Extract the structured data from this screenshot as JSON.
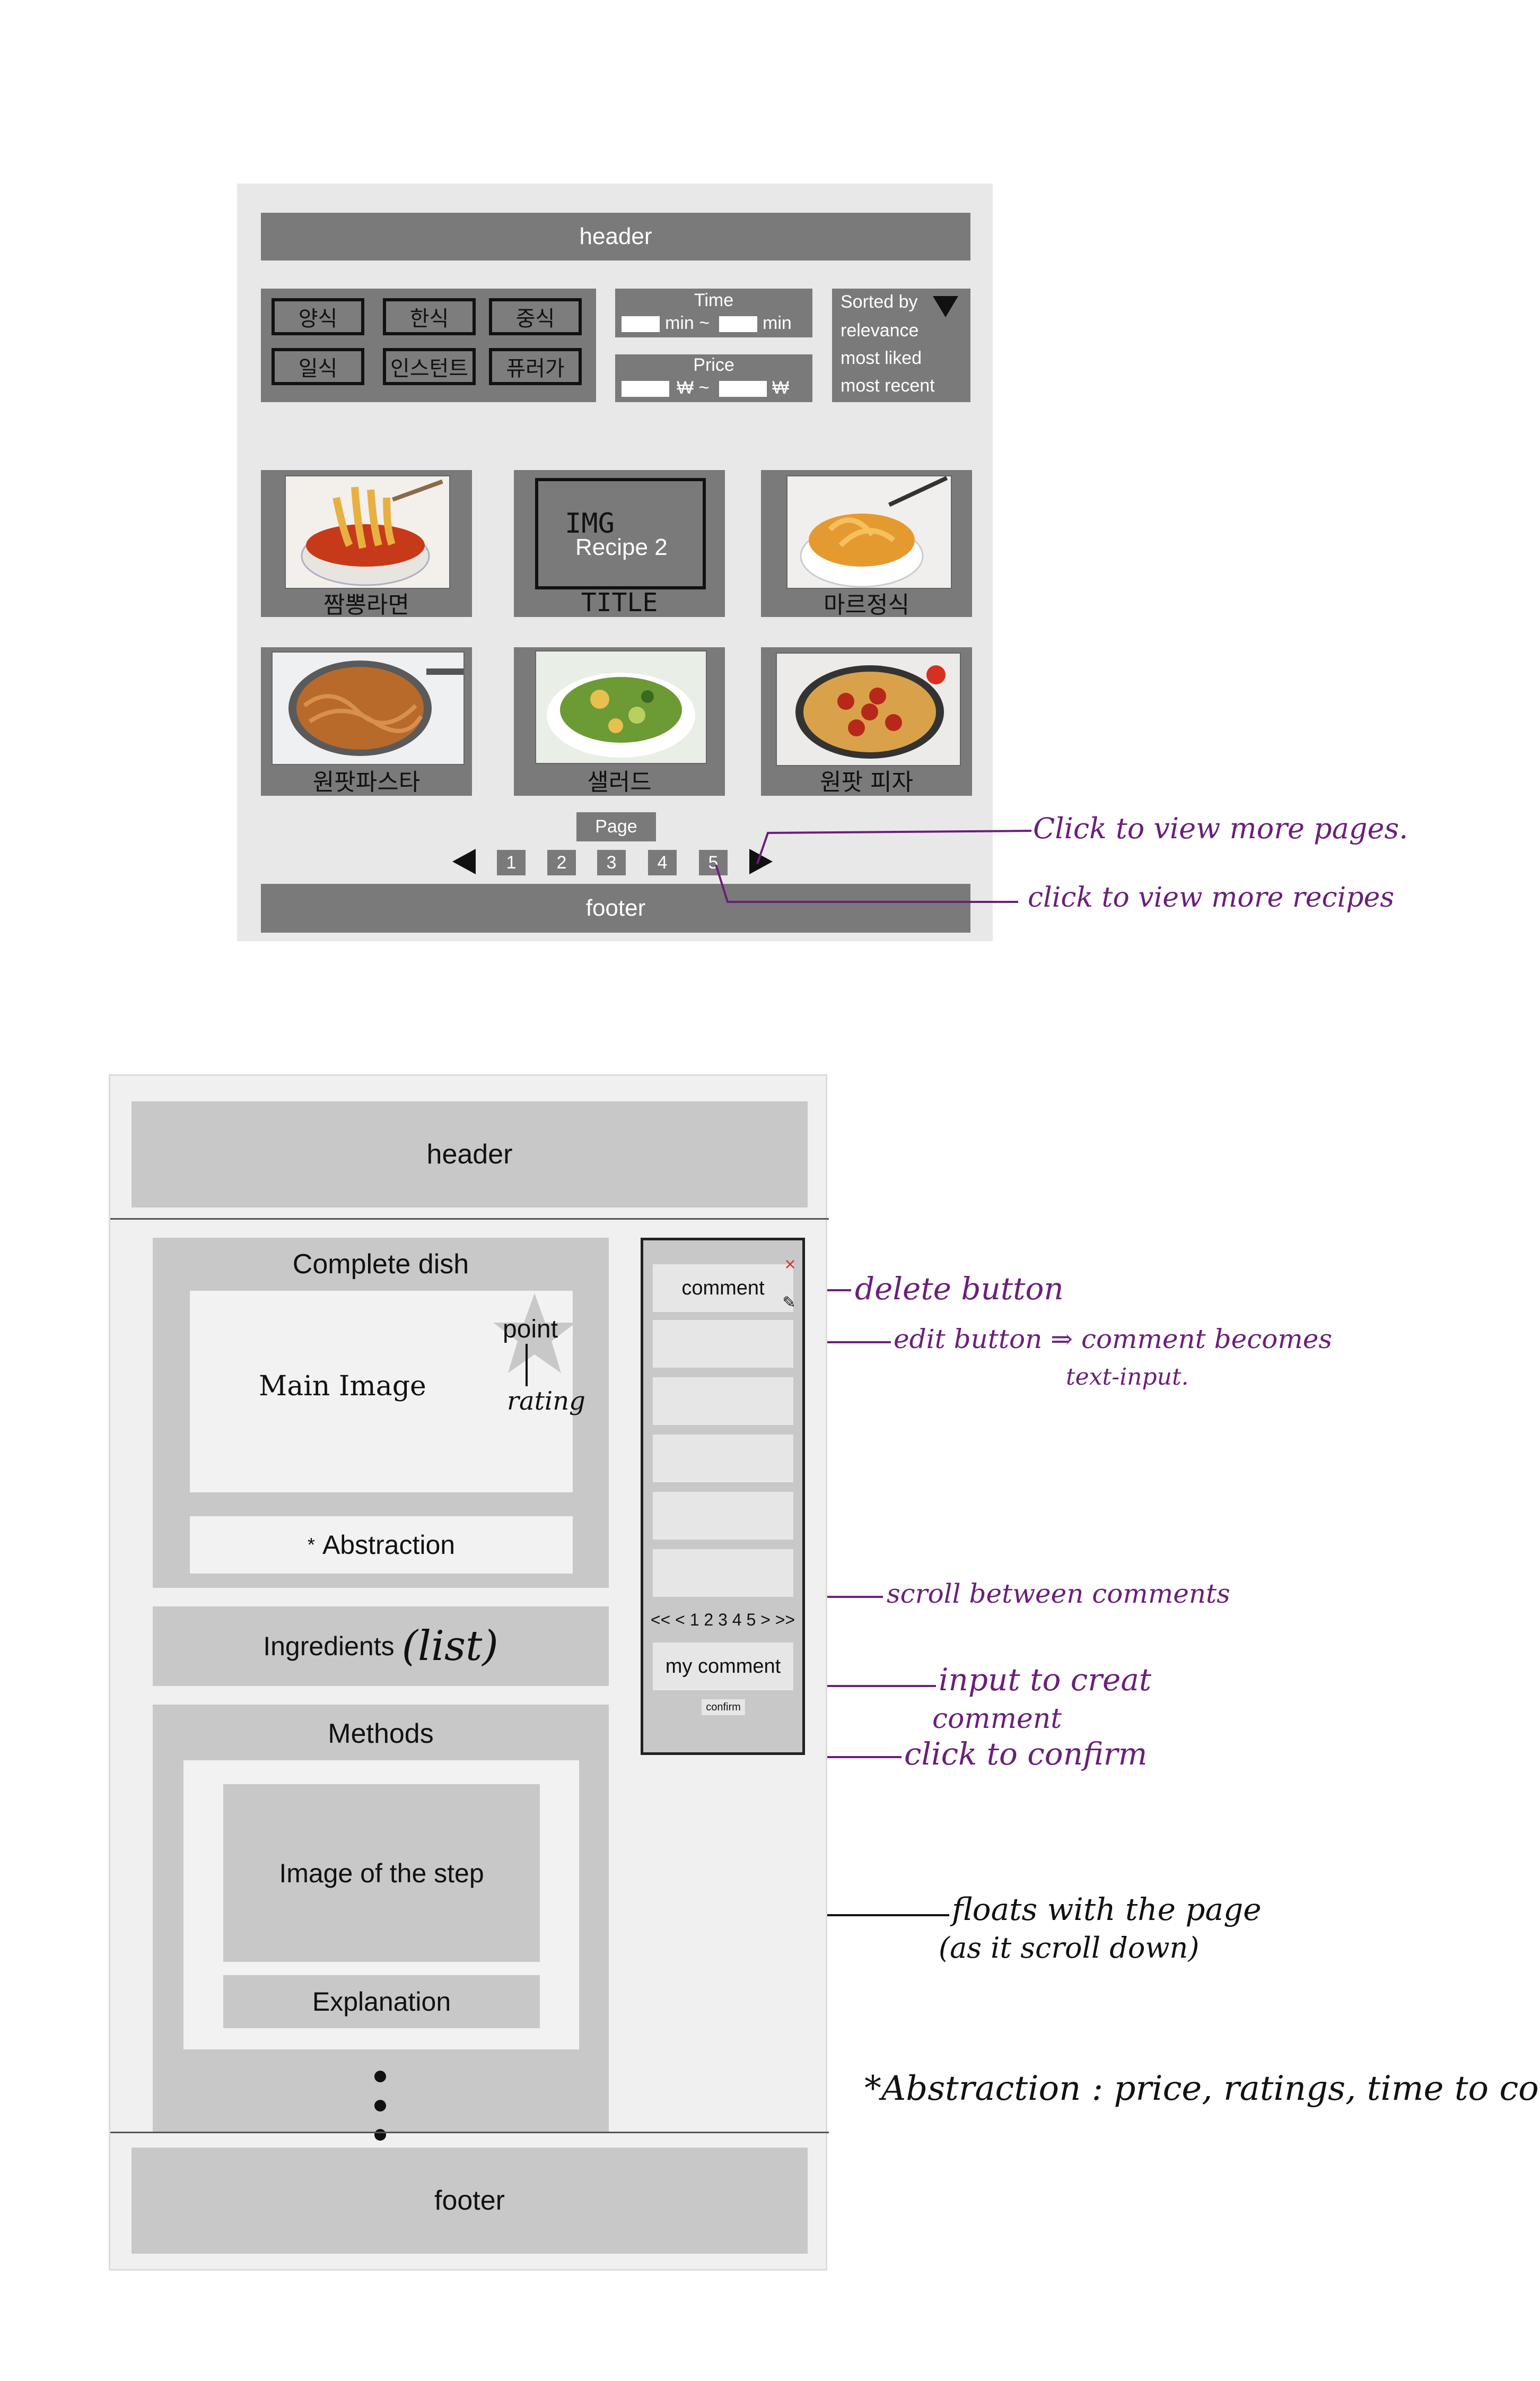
{
  "wireframe1": {
    "header": "header",
    "footer": "footer",
    "categories": [
      "양식",
      "한식",
      "중식",
      "일식",
      "인스턴트",
      "퓨러가"
    ],
    "time_filter": {
      "label": "Time",
      "unit_min": "min ~",
      "unit_max": "min"
    },
    "price_filter": {
      "label": "Price",
      "unit_min": "₩ ~",
      "unit_max": "₩"
    },
    "sort": {
      "label": "Sorted by",
      "options": [
        "relevance",
        "most liked",
        "most recent"
      ]
    },
    "recipes": [
      {
        "title": "짬뽕라면",
        "kind": "photo"
      },
      {
        "title": "TITLE",
        "kind": "placeholder",
        "img_text": "IMG",
        "sub_text": "Recipe 2"
      },
      {
        "title": "마르정식",
        "kind": "photo"
      },
      {
        "title": "원팟파스타",
        "kind": "photo"
      },
      {
        "title": "샐러드",
        "kind": "photo"
      },
      {
        "title": "원팟 피자",
        "kind": "photo"
      }
    ],
    "pagination": {
      "label": "Page",
      "pages": [
        "1",
        "2",
        "3",
        "4",
        "5"
      ]
    }
  },
  "annotations1": {
    "next_pages": "Click to view more pages.",
    "more_recipes": "click to view more recipes"
  },
  "wireframe2": {
    "header": "header",
    "footer": "footer",
    "complete_dish": "Complete dish",
    "main_image": "Main Image",
    "point": "point",
    "rating": "rating",
    "abstraction": "Abstraction",
    "abstraction_star": "*",
    "ingredients": "Ingredients",
    "ingredients_note": "(list)",
    "methods": "Methods",
    "step_image": "Image of the step",
    "explanation": "Explanation",
    "comments": {
      "first": "comment",
      "pager": "<< < 1 2 3 4 5 > >>",
      "my_comment": "my comment",
      "confirm": "confirm"
    }
  },
  "annotations2": {
    "delete": "delete button",
    "edit": "edit button ⇒ comment becomes",
    "edit_cont": "text-input.",
    "scroll": "scroll between comments",
    "input": "input to creat",
    "input_cont": "comment",
    "confirm": "click to confirm",
    "floats": "floats with the page",
    "floats_cont": "(as it scroll down)",
    "abstraction_note": "*Abstraction : price, ratings, time to cook...",
    "colors": {
      "ink": "#6b1f7a",
      "wire_dark": "#7a7a7a",
      "wire_light": "#c8c8c8"
    }
  }
}
